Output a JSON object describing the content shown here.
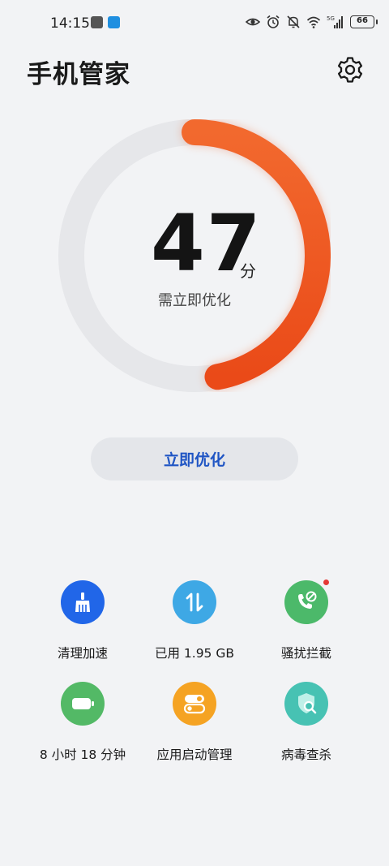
{
  "status_bar": {
    "time": "14:15",
    "battery_level": "66",
    "network": "5G"
  },
  "header": {
    "title": "手机管家"
  },
  "score": {
    "value": "47",
    "unit": "分",
    "hint": "需立即优化",
    "progress_percent": 47,
    "gradient_start": "#f2692e",
    "gradient_end": "#ea4a18",
    "track_color": "#e6e7ea"
  },
  "optimize_button": {
    "label": "立即优化",
    "color": "#1f55c4"
  },
  "features": [
    {
      "label": "清理加速",
      "icon": "broom-icon",
      "color": "#2166e8"
    },
    {
      "label": "已用 1.95 GB",
      "icon": "transfer-arrows-icon",
      "color": "#3ea8e5"
    },
    {
      "label": "骚扰拦截",
      "icon": "blocked-call-icon",
      "color": "#4cb96a",
      "has_badge": true
    },
    {
      "label": "8 小时 18 分钟",
      "icon": "battery-icon",
      "color": "#53b966"
    },
    {
      "label": "应用启动管理",
      "icon": "toggle-switch-icon",
      "color": "#f5a323"
    },
    {
      "label": "病毒查杀",
      "icon": "shield-search-icon",
      "color": "#47c2b3"
    }
  ]
}
